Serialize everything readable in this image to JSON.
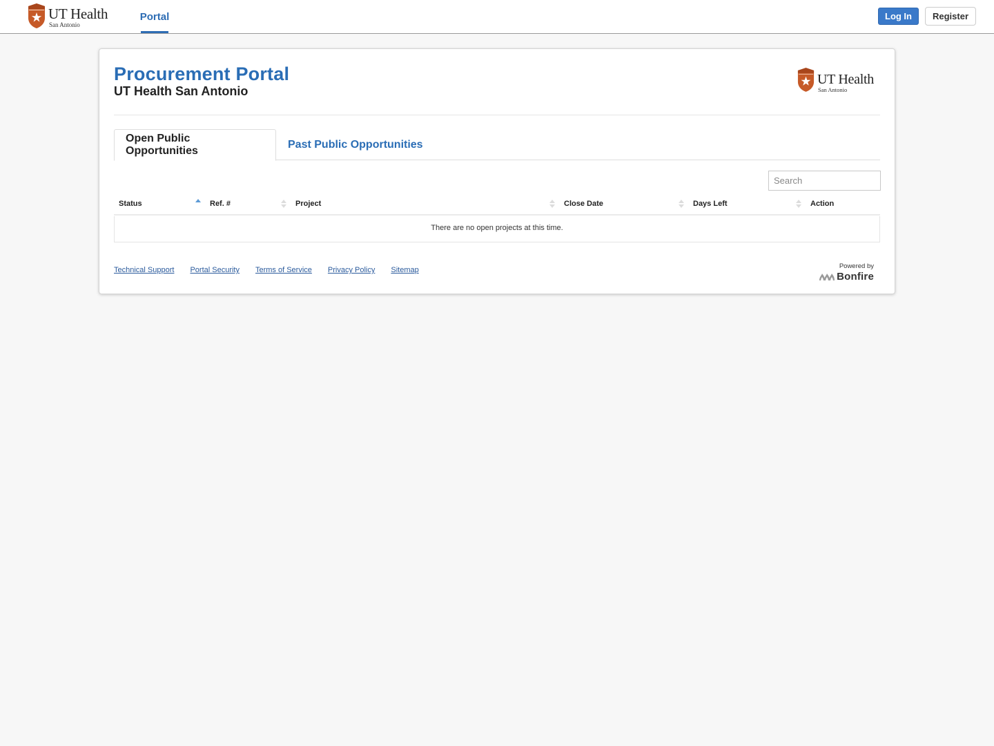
{
  "topnav": {
    "brand": {
      "name": "UT Health",
      "sub": "San Antonio"
    },
    "nav_items": [
      {
        "label": "Portal",
        "active": true
      }
    ],
    "login_label": "Log In",
    "register_label": "Register"
  },
  "header": {
    "title": "Procurement Portal",
    "subtitle": "UT Health San Antonio",
    "logo": {
      "name": "UT Health",
      "sub": "San Antonio"
    }
  },
  "tabs": [
    {
      "label": "Open Public Opportunities",
      "active": true
    },
    {
      "label": "Past Public Opportunities",
      "active": false
    }
  ],
  "search": {
    "placeholder": "Search",
    "value": ""
  },
  "table": {
    "columns": [
      {
        "label": "Status",
        "sort": "asc"
      },
      {
        "label": "Ref. #",
        "sort": "none"
      },
      {
        "label": "Project",
        "sort": "none"
      },
      {
        "label": "Close Date",
        "sort": "none"
      },
      {
        "label": "Days Left",
        "sort": "none"
      },
      {
        "label": "Action",
        "sort": "none"
      }
    ],
    "rows": [],
    "empty_message": "There are no open projects at this time."
  },
  "footer": {
    "links": [
      "Technical Support",
      "Portal Security",
      "Terms of Service",
      "Privacy Policy",
      "Sitemap"
    ],
    "powered_by": "Powered by",
    "vendor": "Bonfire"
  },
  "colors": {
    "accent": "#2a6db5",
    "login_button": "#3a79c9",
    "brand_orange": "#c65a28",
    "sort_active": "#5c9ad6",
    "background": "#f7f7f7"
  }
}
